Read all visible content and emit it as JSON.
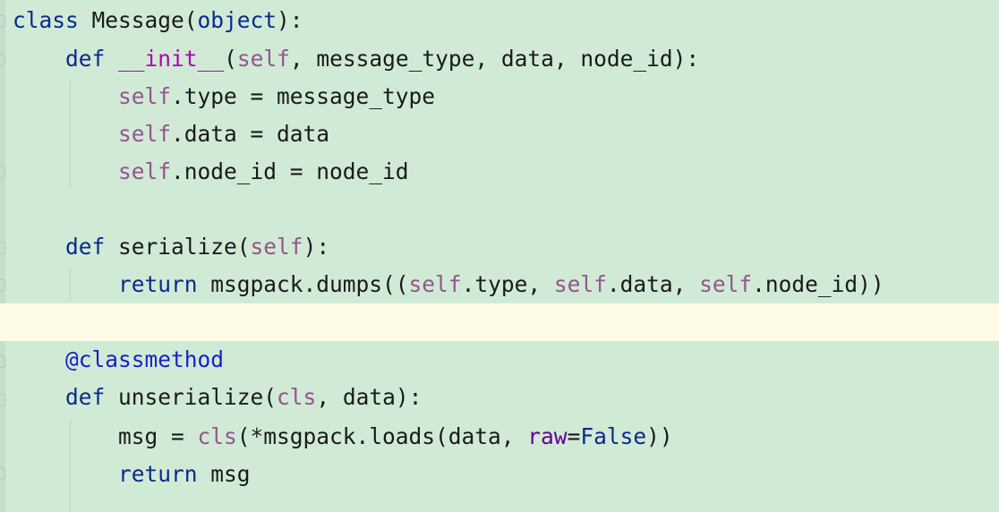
{
  "editor": {
    "language": "python",
    "colors": {
      "background": "#d0ead6",
      "current_line": "#fdfbe6",
      "keyword": "#0a2a8c",
      "self": "#94558d",
      "magic": "#b200b2",
      "decorator": "#1a1fc8",
      "named_param": "#660099"
    },
    "lines": [
      {
        "tokens": [
          [
            "kw",
            "class"
          ],
          [
            "plain",
            " Message("
          ],
          [
            "kw",
            "object"
          ],
          [
            "plain",
            "):"
          ]
        ]
      },
      {
        "tokens": [
          [
            "plain",
            "    "
          ],
          [
            "kw",
            "def"
          ],
          [
            "plain",
            " "
          ],
          [
            "magic",
            "__init__"
          ],
          [
            "plain",
            "("
          ],
          [
            "self",
            "self"
          ],
          [
            "plain",
            ", message_type, data, node_id):"
          ]
        ]
      },
      {
        "tokens": [
          [
            "plain",
            "        "
          ],
          [
            "self",
            "self"
          ],
          [
            "plain",
            ".type = message_type"
          ]
        ]
      },
      {
        "tokens": [
          [
            "plain",
            "        "
          ],
          [
            "self",
            "self"
          ],
          [
            "plain",
            ".data = data"
          ]
        ]
      },
      {
        "tokens": [
          [
            "plain",
            "        "
          ],
          [
            "self",
            "self"
          ],
          [
            "plain",
            ".node_id = node_id"
          ]
        ]
      },
      {
        "tokens": []
      },
      {
        "tokens": [
          [
            "plain",
            "    "
          ],
          [
            "kw",
            "def"
          ],
          [
            "plain",
            " serialize("
          ],
          [
            "self",
            "self"
          ],
          [
            "plain",
            "):"
          ]
        ]
      },
      {
        "tokens": [
          [
            "plain",
            "        "
          ],
          [
            "kw",
            "return"
          ],
          [
            "plain",
            " msgpack.dumps(("
          ],
          [
            "self",
            "self"
          ],
          [
            "plain",
            ".type, "
          ],
          [
            "self",
            "self"
          ],
          [
            "plain",
            ".data, "
          ],
          [
            "self",
            "self"
          ],
          [
            "plain",
            ".node_id))"
          ]
        ]
      },
      {
        "tokens": []
      },
      {
        "tokens": [
          [
            "plain",
            "    "
          ],
          [
            "deco",
            "@classmethod"
          ]
        ]
      },
      {
        "tokens": [
          [
            "plain",
            "    "
          ],
          [
            "kw",
            "def"
          ],
          [
            "plain",
            " unserialize("
          ],
          [
            "self",
            "cls"
          ],
          [
            "plain",
            ", data):"
          ]
        ]
      },
      {
        "tokens": [
          [
            "plain",
            "        msg = "
          ],
          [
            "self",
            "cls"
          ],
          [
            "plain",
            "(*msgpack.loads(data, "
          ],
          [
            "param",
            "raw"
          ],
          [
            "plain",
            "="
          ],
          [
            "kw",
            "False"
          ],
          [
            "plain",
            "))"
          ]
        ]
      },
      {
        "tokens": [
          [
            "plain",
            "        "
          ],
          [
            "kw",
            "return"
          ],
          [
            "plain",
            " msg"
          ]
        ]
      }
    ]
  }
}
